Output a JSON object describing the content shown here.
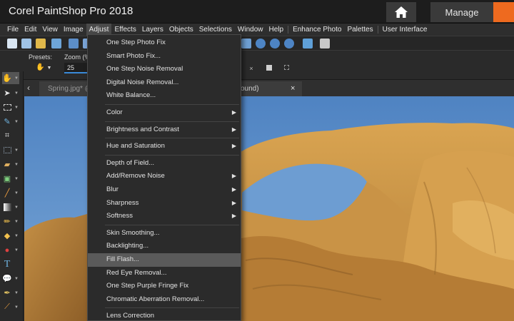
{
  "app": {
    "title": "Corel PaintShop Pro 2018",
    "manage_label": "Manage",
    "accent": "#ee6a1f"
  },
  "menubar": {
    "items": [
      "File",
      "Edit",
      "View",
      "Image",
      "Adjust",
      "Effects",
      "Layers",
      "Objects",
      "Selections",
      "Window",
      "Help"
    ],
    "extra": [
      "Enhance Photo",
      "Palettes",
      "User Interface"
    ],
    "active": "Adjust"
  },
  "tool_options": {
    "presets_label": "Presets:",
    "zoom_label": "Zoom (%",
    "zoom_value": "25"
  },
  "tabs": {
    "spring_label": "Spring.jpg* @",
    "active_label": "ound)",
    "close_glyph": "×"
  },
  "adjust_menu": {
    "groups": [
      [
        "One Step Photo Fix",
        "Smart Photo Fix...",
        "One Step Noise Removal",
        "Digital Noise Removal...",
        "White Balance..."
      ],
      [
        "Color"
      ],
      [
        "Brightness and Contrast"
      ],
      [
        "Hue and Saturation"
      ],
      [
        "Depth of Field...",
        "Add/Remove Noise",
        "Blur",
        "Sharpness",
        "Softness"
      ],
      [
        "Skin Smoothing...",
        "Backlighting...",
        "Fill Flash...",
        "Red Eye Removal...",
        "One Step Purple Fringe Fix",
        "Chromatic Aberration Removal..."
      ],
      [
        "Lens Correction"
      ]
    ],
    "submenu_items": [
      "Color",
      "Brightness and Contrast",
      "Hue and Saturation",
      "Add/Remove Noise",
      "Blur",
      "Sharpness",
      "Softness"
    ],
    "highlighted": "Fill Flash..."
  }
}
